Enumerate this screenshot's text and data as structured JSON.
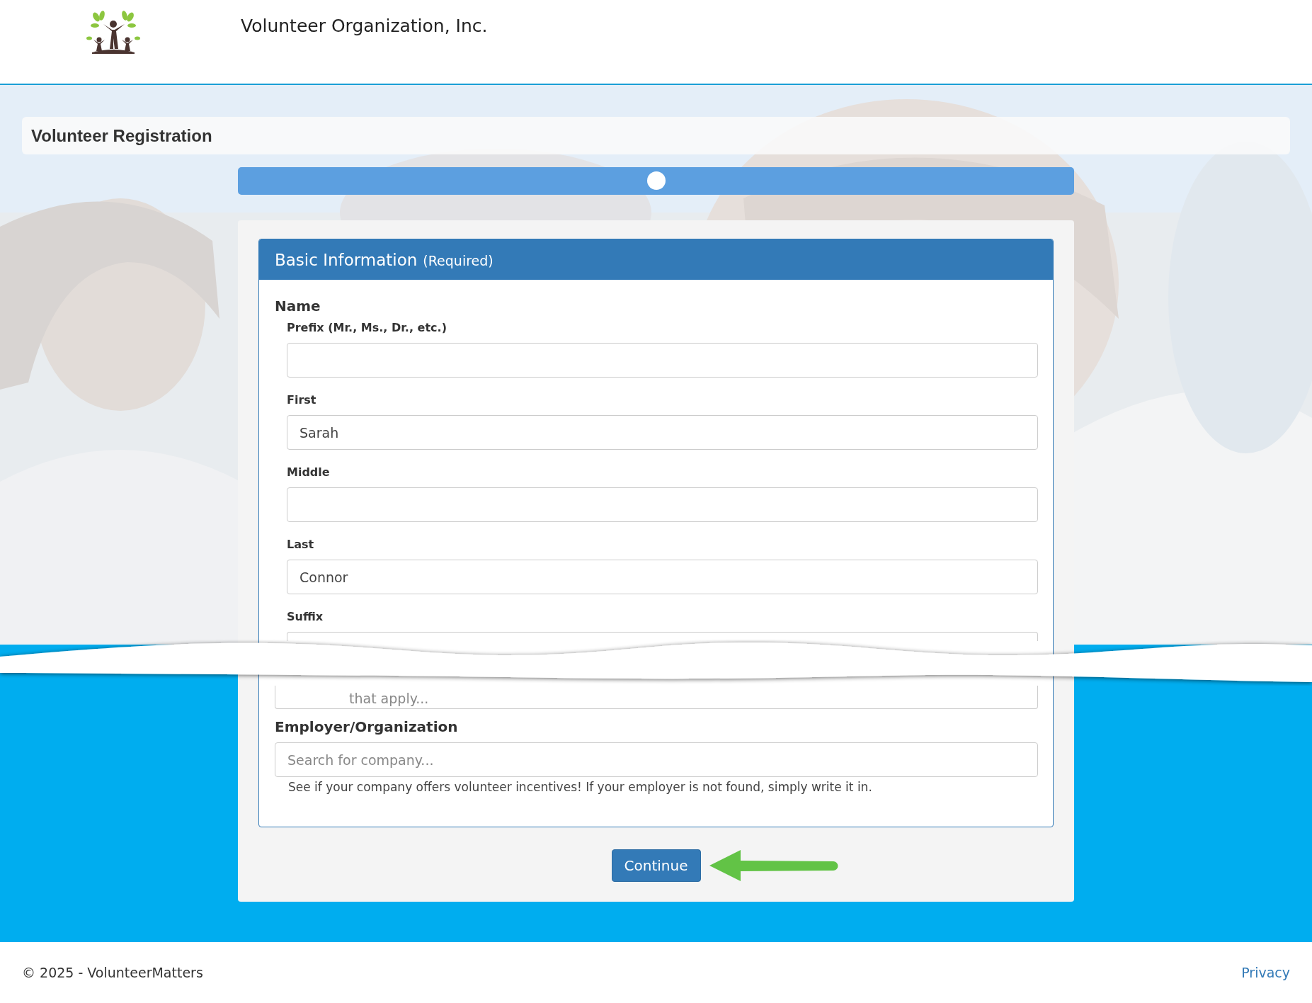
{
  "header": {
    "title": "Volunteer Organization, Inc."
  },
  "page_title": "Volunteer Registration",
  "progress": {
    "level": 0.5
  },
  "panel": {
    "title": "Basic Information",
    "note": "(Required)",
    "section": "Name",
    "fields": [
      {
        "label": "Prefix (Mr., Ms., Dr., etc.)"
      },
      {
        "label": "First",
        "value": "Sarah"
      },
      {
        "label": "Middle"
      },
      {
        "label": "Last",
        "value": "Connor"
      },
      {
        "label": "Suffix"
      }
    ],
    "interests": {
      "placeholder": "that apply..."
    },
    "employer": {
      "label": "Employer/Organization",
      "placeholder": "Search for company...",
      "help": "See if your company offers volunteer incentives! If your employer is not found, simply write it in."
    }
  },
  "continue_button": "Continue",
  "footer": {
    "copyright": "© 2025 - VolunteerMatters",
    "privacy_link": "Privacy"
  }
}
